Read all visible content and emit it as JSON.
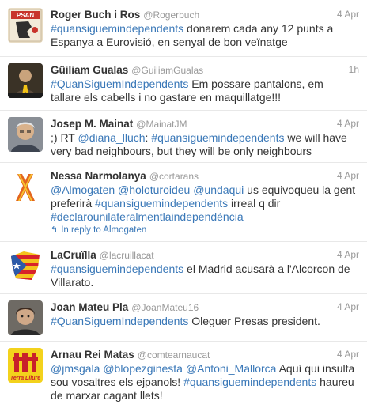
{
  "tweets": [
    {
      "name": "Roger Buch i Ros",
      "handle": "@Rogerbuch",
      "time": "4 Apr",
      "avatar": "psan-poster-avatar",
      "avatar_text": "PSAN",
      "parts": [
        {
          "t": "#quansiguemindependents",
          "link": true
        },
        {
          "t": " donarem cada any 12 punts a Espanya a Eurovisió, en senyal de bon veïnatge",
          "link": false
        }
      ]
    },
    {
      "name": "Güiliam Gualas",
      "handle": "@GuiliamGualas",
      "time": "1h",
      "avatar": "person-yellow-ribbon-avatar",
      "parts": [
        {
          "t": "#QuanSiguemIndependents",
          "link": true
        },
        {
          "t": " Em possare pantalons, em tallare els cabells i no gastare en maquillatge!!!",
          "link": false
        }
      ]
    },
    {
      "name": "Josep M. Mainat",
      "handle": "@MainatJM",
      "time": "4 Apr",
      "avatar": "grey-haired-man-avatar",
      "parts": [
        {
          "t": ";) RT ",
          "link": false
        },
        {
          "t": "@diana_lluch",
          "link": true
        },
        {
          "t": ": ",
          "link": false
        },
        {
          "t": "#quansiguemindependents",
          "link": true
        },
        {
          "t": " we will have very bad neighbours, but they will be only neighbours",
          "link": false
        }
      ]
    },
    {
      "name": "Nessa Narmolanya",
      "handle": "@cortarans",
      "time": "4 Apr",
      "avatar": "catalan-ribbon-avatar",
      "parts": [
        {
          "t": "@Almogaten",
          "link": true
        },
        {
          "t": " ",
          "link": false
        },
        {
          "t": "@holoturoideu",
          "link": true
        },
        {
          "t": " ",
          "link": false
        },
        {
          "t": "@undaqui",
          "link": true
        },
        {
          "t": " us equivoqueu la gent preferirà ",
          "link": false
        },
        {
          "t": "#quansiguemindependents",
          "link": true
        },
        {
          "t": " irreal q dir ",
          "link": false
        },
        {
          "t": "#declarounilateralmentlaindependència",
          "link": true
        }
      ],
      "reply": "In reply to Almogaten"
    },
    {
      "name": "LaCruïlla",
      "handle": "@lacruillacat",
      "time": "4 Apr",
      "avatar": "estelada-map-avatar",
      "parts": [
        {
          "t": "#quansiguemindependents",
          "link": true
        },
        {
          "t": " el Madrid acusarà a l'Alcorcon de Villarato.",
          "link": false
        }
      ]
    },
    {
      "name": "Joan Mateu Pla",
      "handle": "@JoanMateu16",
      "time": "4 Apr",
      "avatar": "young-man-avatar",
      "parts": [
        {
          "t": "#QuanSiguemIndependents",
          "link": true
        },
        {
          "t": " Oleguer Presas president.",
          "link": false
        }
      ]
    },
    {
      "name": "Arnau Rei Matas",
      "handle": "@comtearnaucat",
      "time": "4 Apr",
      "avatar": "terra-lliure-logo-avatar",
      "avatar_text": "Terra Lliure",
      "parts": [
        {
          "t": "@jmsgala",
          "link": true
        },
        {
          "t": " ",
          "link": false
        },
        {
          "t": "@blopezginesta",
          "link": true
        },
        {
          "t": " ",
          "link": false
        },
        {
          "t": "@Antoni_Mallorca",
          "link": true
        },
        {
          "t": " Aquí qui insulta sou vosaltres els ejpanols! ",
          "link": false
        },
        {
          "t": "#quansiguemindependents",
          "link": true
        },
        {
          "t": " haureu de marxar cagant llets!",
          "link": false
        }
      ]
    }
  ]
}
